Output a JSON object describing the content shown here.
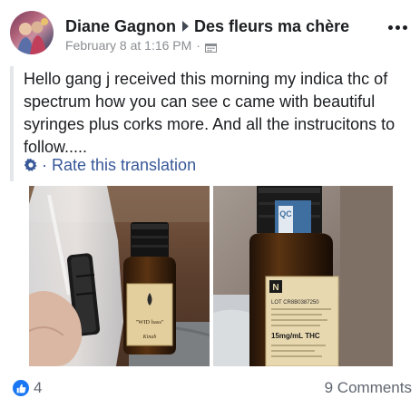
{
  "post": {
    "author": "Diane Gagnon",
    "group": "Des fleurs ma chère",
    "timestamp": "February 8 at 1:16 PM",
    "separator": "·",
    "audience_icon": "calendar-audience-icon",
    "more_icon": "ellipsis-icon",
    "text": "Hello gang j received this morning my indica thc of spectrum how you can see c came with beautiful syringes plus corks more. And all the instrucitons to follow.....",
    "translation_link": "Rate this translation",
    "translation_icon": "gear-icon"
  },
  "photos": [
    {
      "name": "photo-syringe-bottle",
      "label_top": "\"WID bass\"",
      "label_sig": "Kinah"
    },
    {
      "name": "photo-bottle-label",
      "lot_text": "LOT CR8B0387250",
      "dose_text": "15mg/mL THC",
      "cap_badge": "QC",
      "label_letter": "N"
    }
  ],
  "footer": {
    "like_count": "4",
    "comments": "9 Comments",
    "like_color": "#1877f2"
  },
  "colors": {
    "link": "#385898",
    "meta": "#8a8d91",
    "text": "#1c1e21"
  }
}
